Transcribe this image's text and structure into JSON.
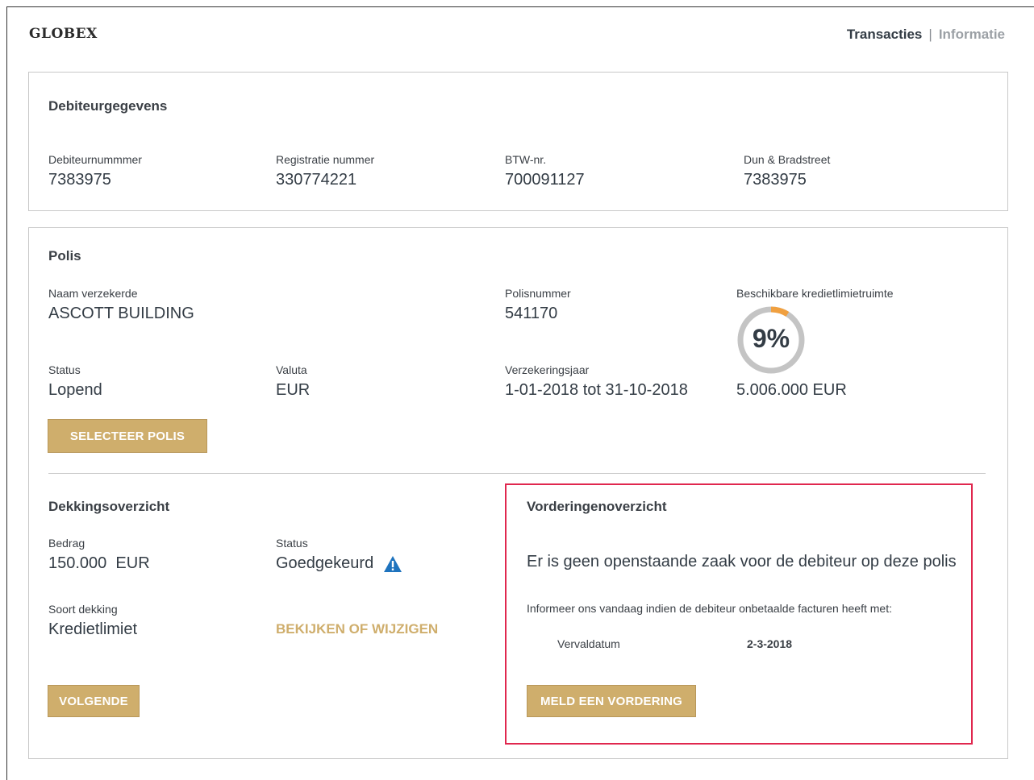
{
  "brand": "GLOBEX",
  "nav": {
    "transacties": "Transacties",
    "separator": "|",
    "informatie": "Informatie"
  },
  "debiteur": {
    "title": "Debiteurgegevens",
    "fields": [
      {
        "label": "Debiteurnummmer",
        "value": "7383975"
      },
      {
        "label": "Registratie nummer",
        "value": "330774221"
      },
      {
        "label": "BTW-nr.",
        "value": "700091127"
      },
      {
        "label": "Dun & Bradstreet",
        "value": "7383975"
      }
    ]
  },
  "polis": {
    "title": "Polis",
    "naam_label": "Naam verzekerde",
    "naam_value": "ASCOTT BUILDING",
    "polisnummer_label": "Polisnummer",
    "polisnummer_value": "541170",
    "krediet_label": "Beschikbare kredietlimietruimte",
    "krediet_percent_text": "9%",
    "krediet_percent": 9,
    "krediet_amount": "5.006.000 EUR",
    "status_label": "Status",
    "status_value": "Lopend",
    "valuta_label": "Valuta",
    "valuta_value": "EUR",
    "jaar_label": "Verzekeringsjaar",
    "jaar_value": "1-01-2018 tot 31-10-2018",
    "select_button": "SELECTEER POLIS"
  },
  "dekking": {
    "title": "Dekkingsoverzicht",
    "bedrag_label": "Bedrag",
    "bedrag_value": "150.000  EUR",
    "status_label": "Status",
    "status_value": "Goedgekeurd",
    "soort_label": "Soort dekking",
    "soort_value": "Kredietlimiet",
    "edit_link": "BEKIJKEN OF WIJZIGEN",
    "next_button": "VOLGENDE"
  },
  "vordering": {
    "title": "Vorderingenoverzicht",
    "message": "Er is geen openstaande zaak voor de debiteur op deze polis",
    "info": "Informeer ons vandaag indien de debiteur onbetaalde facturen heeft met:",
    "vervaldatum_label": "Vervaldatum",
    "vervaldatum_value": "2-3-2018",
    "button": "MELD EEN VORDERING"
  },
  "colors": {
    "accent": "#cfae6c",
    "gauge_fill": "#f0a040",
    "gauge_track": "#c4c4c4",
    "highlight": "#e0274e",
    "warning": "#1e73be"
  }
}
